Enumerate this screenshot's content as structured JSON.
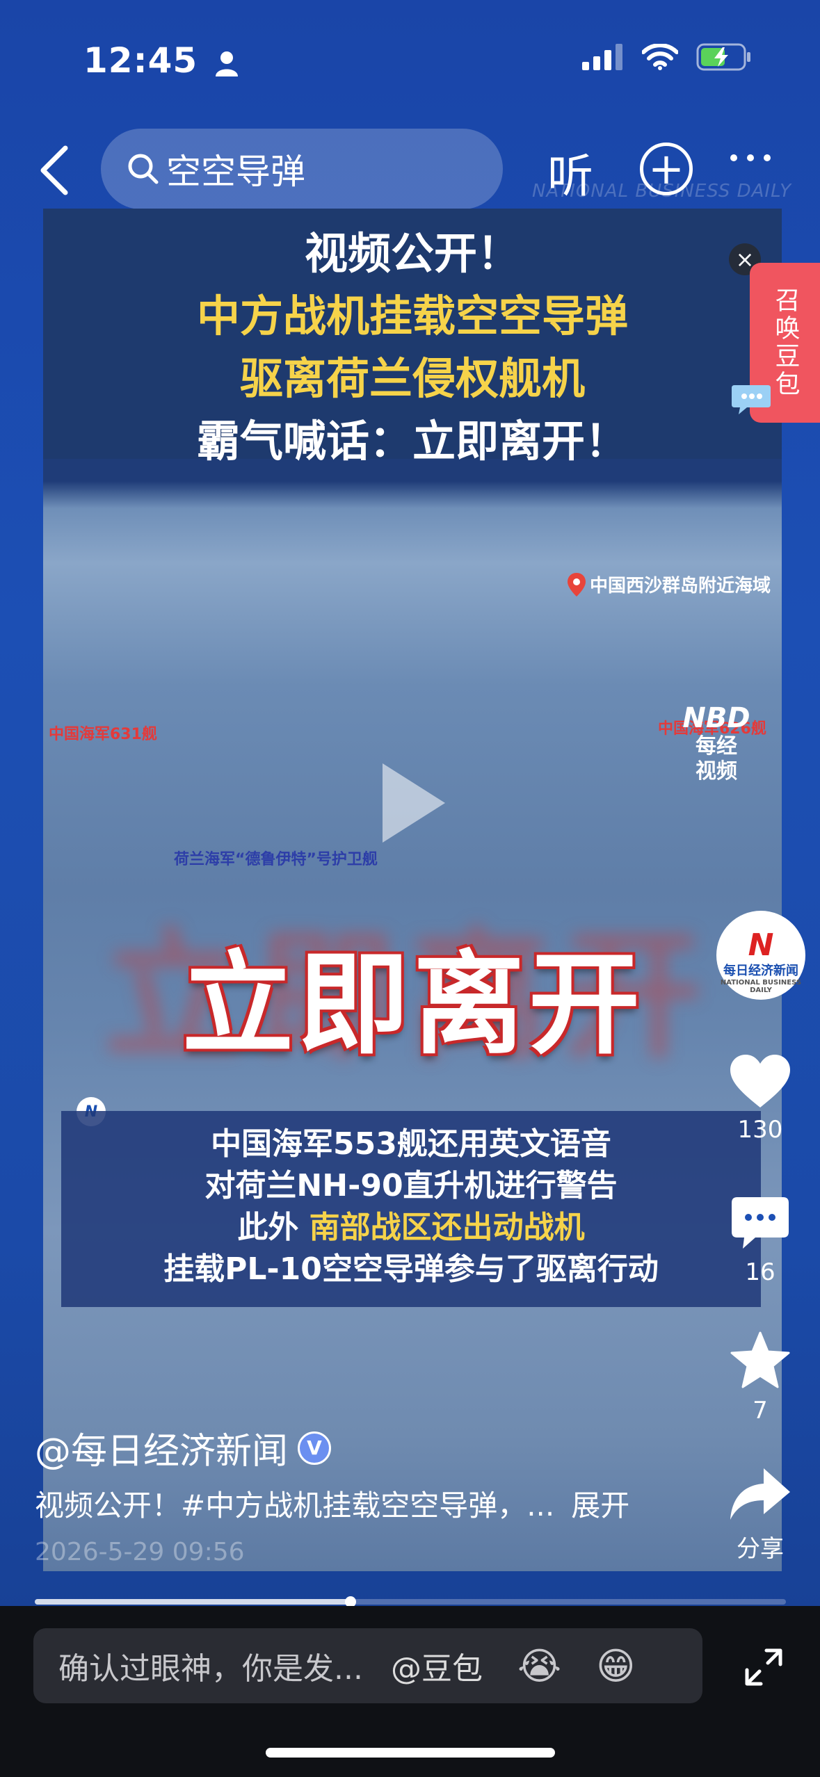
{
  "status_bar": {
    "time": "12:45"
  },
  "header": {
    "search_text": "空空导弹",
    "listen_label": "听",
    "plus_label": "+",
    "watermark": "NATIONAL BUSINESS DAILY"
  },
  "video": {
    "banner_lines": [
      "视频公开！",
      "中方战机挂载空空导弹",
      "驱离荷兰侵权舰机",
      "霸气喊话：立即离开！"
    ],
    "location": "中国西沙群岛附近海域",
    "ship_labels": [
      "中国海军631舰",
      "中国海军626舰",
      "荷兰海军“德鲁伊特”号护卫舰"
    ],
    "nbd_logo": {
      "mark": "NBD",
      "text1": "每经",
      "text2": "视频"
    },
    "big_text": "立即离开",
    "caption_lines": [
      "中国海军553舰还用英文语音",
      "对荷兰NH-90直升机进行警告",
      "此外",
      "南部战区还出动战机",
      "挂载PL-10空空导弹参与了驱离行动"
    ],
    "close_label": "×",
    "doubao_label": "召唤豆包",
    "progress_fraction": 0.42
  },
  "rail": {
    "avatar_name": "每日经济新闻",
    "avatar_sub": "NATIONAL BUSINESS DAILY",
    "like_count": "130",
    "comment_count": "16",
    "favorite_count": "7",
    "share_label": "分享"
  },
  "post": {
    "author": "@每日经济新闻",
    "verified_mark": "V",
    "description": "视频公开！#中方战机挂载空空导弹，...",
    "expand_label": "展开",
    "date": "2026-5-29 09:56"
  },
  "bottom": {
    "input_placeholder": "确认过眼神，你是发...",
    "mention": "@豆包",
    "emoji1": "😭",
    "emoji2": "😁"
  },
  "colors": {
    "accent_yellow": "#f6d34a",
    "doubao_red": "#f0555f",
    "bg_blue": "#1c4fb4"
  }
}
